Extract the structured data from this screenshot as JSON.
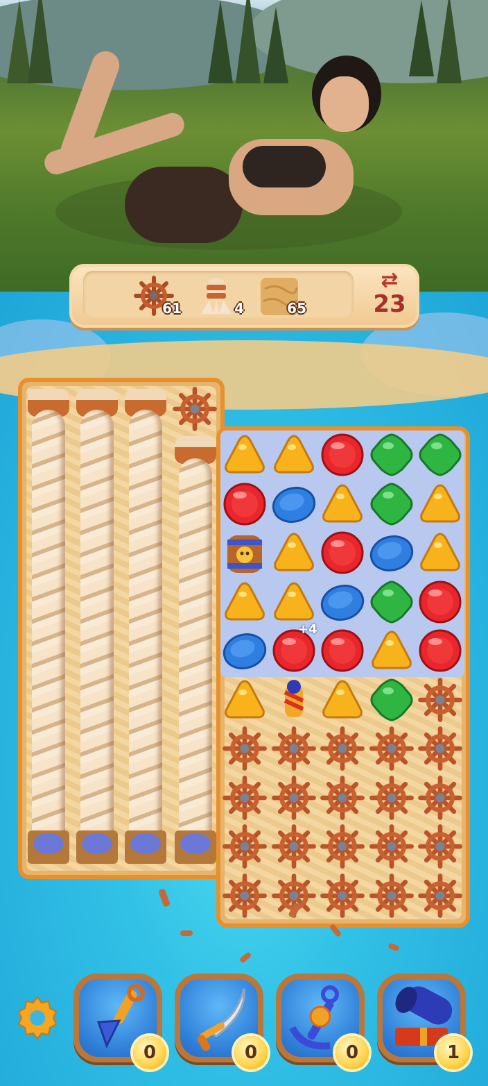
{
  "goals": [
    {
      "name": "ship-wheel",
      "count": "61"
    },
    {
      "name": "rope",
      "count": "4"
    },
    {
      "name": "sand",
      "count": "65"
    }
  ],
  "moves": {
    "icon": "swap-arrows-icon",
    "count": "23"
  },
  "grid": {
    "rows": [
      [
        "yellow-triangle",
        "yellow-triangle",
        "red-circle",
        "green-diamond",
        "green-diamond"
      ],
      [
        "red-circle",
        "blue-oval",
        "yellow-triangle",
        "green-diamond",
        "yellow-triangle"
      ],
      [
        "pirate-barrel",
        "yellow-triangle",
        "red-circle",
        "blue-oval",
        "yellow-triangle"
      ],
      [
        "yellow-triangle",
        "yellow-triangle",
        "blue-oval",
        "green-diamond",
        "red-circle"
      ],
      [
        "blue-oval",
        "red-circle",
        "red-circle",
        "yellow-triangle",
        "red-circle"
      ],
      [
        "yellow-triangle",
        "firework-rocket",
        "yellow-triangle",
        "green-diamond",
        "ship-wheel"
      ],
      [
        "ship-wheel",
        "ship-wheel",
        "ship-wheel",
        "ship-wheel",
        "ship-wheel"
      ],
      [
        "ship-wheel",
        "ship-wheel",
        "ship-wheel",
        "ship-wheel",
        "ship-wheel"
      ],
      [
        "ship-wheel",
        "ship-wheel",
        "ship-wheel",
        "ship-wheel",
        "ship-wheel"
      ],
      [
        "ship-wheel",
        "ship-wheel",
        "ship-wheel",
        "ship-wheel",
        "ship-wheel"
      ]
    ],
    "combo_text": "+4"
  },
  "colors": {
    "red": "#e8262b",
    "yellow": "#f7b21c",
    "blue": "#2f7fe0",
    "green": "#2fb642",
    "wheel": "#b8532a",
    "frame": "#e7902d"
  },
  "boosters": [
    {
      "name": "shovel",
      "count": "0"
    },
    {
      "name": "sabre",
      "count": "0"
    },
    {
      "name": "anchor",
      "count": "0"
    },
    {
      "name": "cannon",
      "count": "1"
    }
  ],
  "settings_icon": "gear-icon"
}
